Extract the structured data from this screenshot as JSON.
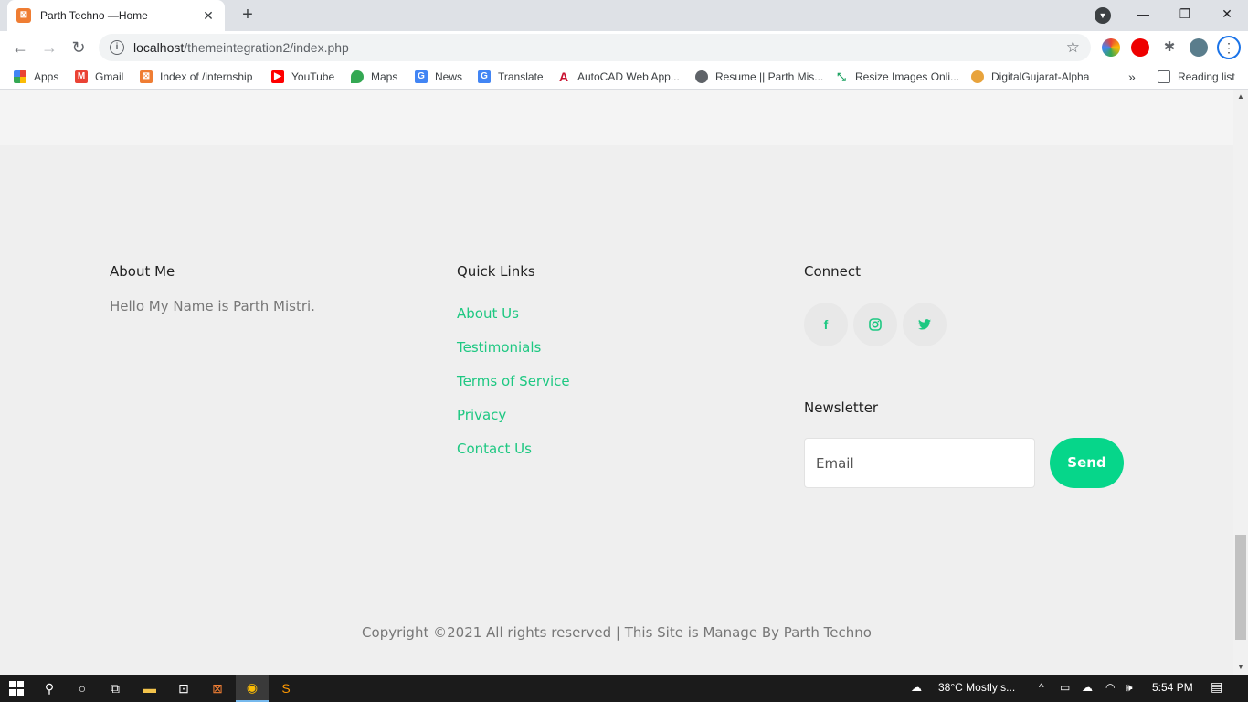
{
  "browser": {
    "tab_title": "Parth Techno —Home",
    "tab_favicon": "xampp-icon",
    "url_host": "localhost",
    "url_path": "/themeintegration2/index.php",
    "bookmarks": [
      {
        "label": "Apps",
        "icon": "apps-grid-icon",
        "color": "#4285f4"
      },
      {
        "label": "Gmail",
        "icon": "gmail-icon",
        "color": "#ea4335"
      },
      {
        "label": "Index of /internship",
        "icon": "xampp-icon",
        "color": "#ef7d33"
      },
      {
        "label": "YouTube",
        "icon": "youtube-icon",
        "color": "#ff0000"
      },
      {
        "label": "Maps",
        "icon": "maps-pin-icon",
        "color": "#34a853"
      },
      {
        "label": "News",
        "icon": "news-icon",
        "color": "#4285f4"
      },
      {
        "label": "Translate",
        "icon": "translate-icon",
        "color": "#4285f4"
      },
      {
        "label": "AutoCAD Web App...",
        "icon": "autocad-icon",
        "color": "#c8102e"
      },
      {
        "label": "Resume || Parth Mis...",
        "icon": "globe-icon",
        "color": "#5f6368"
      },
      {
        "label": "Resize Images Onli...",
        "icon": "resize-icon",
        "color": "#1ea362"
      },
      {
        "label": "DigitalGujarat-Alpha",
        "icon": "digitalgujarat-icon",
        "color": "#e8a33c"
      }
    ],
    "more_bookmarks": "»",
    "reading_list": "Reading list"
  },
  "footer": {
    "about": {
      "title": "About Me",
      "text": "Hello My Name is Parth Mistri."
    },
    "quick_links": {
      "title": "Quick Links",
      "items": [
        "About Us",
        "Testimonials",
        "Terms of Service",
        "Privacy",
        "Contact Us"
      ]
    },
    "connect": {
      "title": "Connect",
      "social": [
        "facebook-icon",
        "instagram-icon",
        "twitter-icon"
      ]
    },
    "newsletter": {
      "title": "Newsletter",
      "email_placeholder": "Email",
      "send_label": "Send"
    },
    "copyright": "Copyright ©2021 All rights reserved | This Site is Manage By Parth Techno"
  },
  "taskbar": {
    "weather": "38°C  Mostly s...",
    "time": "5:54 PM"
  },
  "colors": {
    "accent": "#1ec882",
    "send_button": "#06d68a"
  }
}
